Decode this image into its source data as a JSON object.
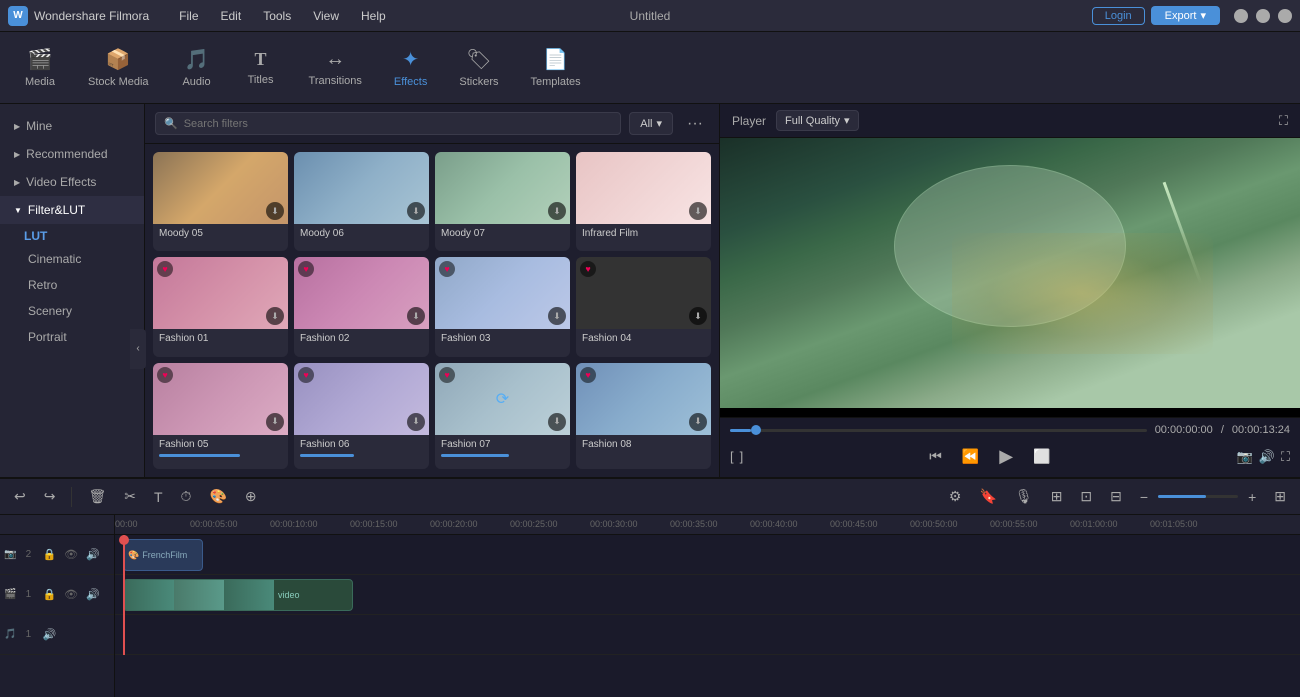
{
  "app": {
    "name": "Wondershare Filmora",
    "doc_title": "Untitled",
    "login_label": "Login",
    "export_label": "Export"
  },
  "menu": {
    "items": [
      "File",
      "Edit",
      "Tools",
      "View",
      "Help"
    ]
  },
  "toolbar": {
    "items": [
      {
        "id": "media",
        "label": "Media",
        "icon": "🎬"
      },
      {
        "id": "stock",
        "label": "Stock Media",
        "icon": "📦"
      },
      {
        "id": "audio",
        "label": "Audio",
        "icon": "🎵"
      },
      {
        "id": "titles",
        "label": "Titles",
        "icon": "T"
      },
      {
        "id": "transitions",
        "label": "Transitions",
        "icon": "↔"
      },
      {
        "id": "effects",
        "label": "Effects",
        "icon": "✨"
      },
      {
        "id": "stickers",
        "label": "Stickers",
        "icon": "🏷"
      },
      {
        "id": "templates",
        "label": "Templates",
        "icon": "📄"
      }
    ]
  },
  "left_panel": {
    "items": [
      {
        "label": "Mine",
        "arrow": "▶"
      },
      {
        "label": "Recommended",
        "arrow": "▶"
      },
      {
        "label": "Video Effects",
        "arrow": "▶"
      },
      {
        "label": "Filter&LUT",
        "arrow": "▼",
        "active": true
      }
    ],
    "sub_items": [
      {
        "label": "LUT",
        "active": true
      },
      {
        "label": "Cinematic"
      },
      {
        "label": "Retro"
      },
      {
        "label": "Scenery"
      },
      {
        "label": "Portrait"
      }
    ]
  },
  "effects": {
    "search_placeholder": "Search filters",
    "all_label": "All",
    "items_row1": [
      {
        "id": "moody05",
        "label": "Moody 05",
        "thumb_class": "thumb-moody05"
      },
      {
        "id": "moody06",
        "label": "Moody 06",
        "thumb_class": "thumb-moody06"
      },
      {
        "id": "moody07",
        "label": "Moody 07",
        "thumb_class": "thumb-moody07"
      },
      {
        "id": "infrared",
        "label": "Infrared Film",
        "thumb_class": "thumb-infrared"
      }
    ],
    "items_row2": [
      {
        "id": "fashion01",
        "label": "Fashion 01",
        "thumb_class": "thumb-fashion01",
        "has_heart": true
      },
      {
        "id": "fashion02",
        "label": "Fashion 02",
        "thumb_class": "thumb-fashion02",
        "has_heart": true
      },
      {
        "id": "fashion03",
        "label": "Fashion 03",
        "thumb_class": "thumb-fashion03",
        "has_heart": true
      },
      {
        "id": "fashion04",
        "label": "Fashion 04",
        "thumb_class": "thumb-fashion04",
        "has_heart": true
      }
    ],
    "items_row3": [
      {
        "id": "fashion05",
        "label": "Fashion 05",
        "thumb_class": "thumb-fashion05",
        "has_heart": true,
        "progress": 60
      },
      {
        "id": "fashion06",
        "label": "Fashion 06",
        "thumb_class": "thumb-fashion06",
        "has_heart": true,
        "progress": 40
      },
      {
        "id": "fashion07",
        "label": "Fashion 07",
        "thumb_class": "thumb-fashion07",
        "has_heart": true,
        "progress": 50
      },
      {
        "id": "fashion08",
        "label": "Fashion 08",
        "thumb_class": "thumb-fashion08",
        "has_heart": true,
        "progress": 0
      }
    ]
  },
  "player": {
    "label": "Player",
    "quality": "Full Quality",
    "current_time": "00:00:00:00",
    "separator": "/",
    "total_time": "00:00:13:24"
  },
  "timeline": {
    "time_marks": [
      "00:00",
      "00:00:05:00",
      "00:00:10:00",
      "00:00:15:00",
      "00:00:20:00",
      "00:00:25:00",
      "00:00:30:00",
      "00:00:35:00",
      "00:00:40:00",
      "00:00:45:00",
      "00:00:50:00",
      "00:00:55:00",
      "00:01:00:00",
      "00:01:05:00"
    ],
    "tracks": [
      {
        "num": 2,
        "type": "video",
        "clips": [
          {
            "label": "FrenchFilm",
            "type": "lut"
          }
        ]
      },
      {
        "num": 1,
        "type": "video",
        "clips": [
          {
            "label": "video",
            "type": "video"
          }
        ]
      },
      {
        "num": 1,
        "type": "audio",
        "clips": []
      }
    ]
  }
}
